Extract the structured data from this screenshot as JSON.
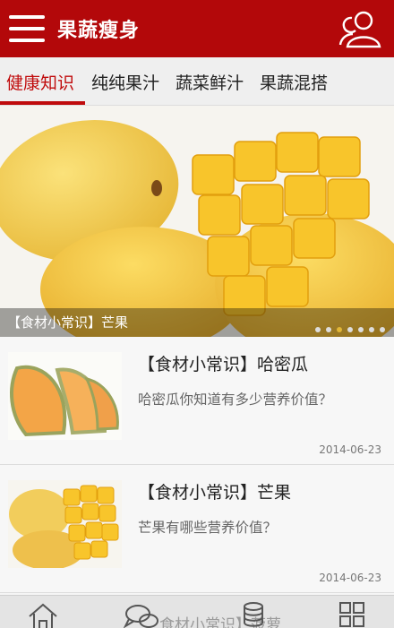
{
  "header": {
    "title": "果蔬瘦身"
  },
  "tabs": [
    {
      "label": "健康知识",
      "active": true
    },
    {
      "label": "纯纯果汁"
    },
    {
      "label": "蔬菜鲜汁"
    },
    {
      "label": "果蔬混搭"
    }
  ],
  "banner": {
    "caption": "【食材小常识】芒果",
    "slide_count": 7,
    "active_slide": 3
  },
  "articles": [
    {
      "title": "【食材小常识】哈密瓜",
      "desc": "哈密瓜你知道有多少营养价值？",
      "date": "2014-06-23"
    },
    {
      "title": "【食材小常识】芒果",
      "desc": "芒果有哪些营养价值？",
      "date": "2014-06-23"
    }
  ],
  "bottom_bar": {
    "overlay_text": "食材小常识】菠萝"
  },
  "colors": {
    "brand_red": "#b3080a",
    "active_tab": "#c00b0c",
    "dot_active": "#e2b636"
  }
}
